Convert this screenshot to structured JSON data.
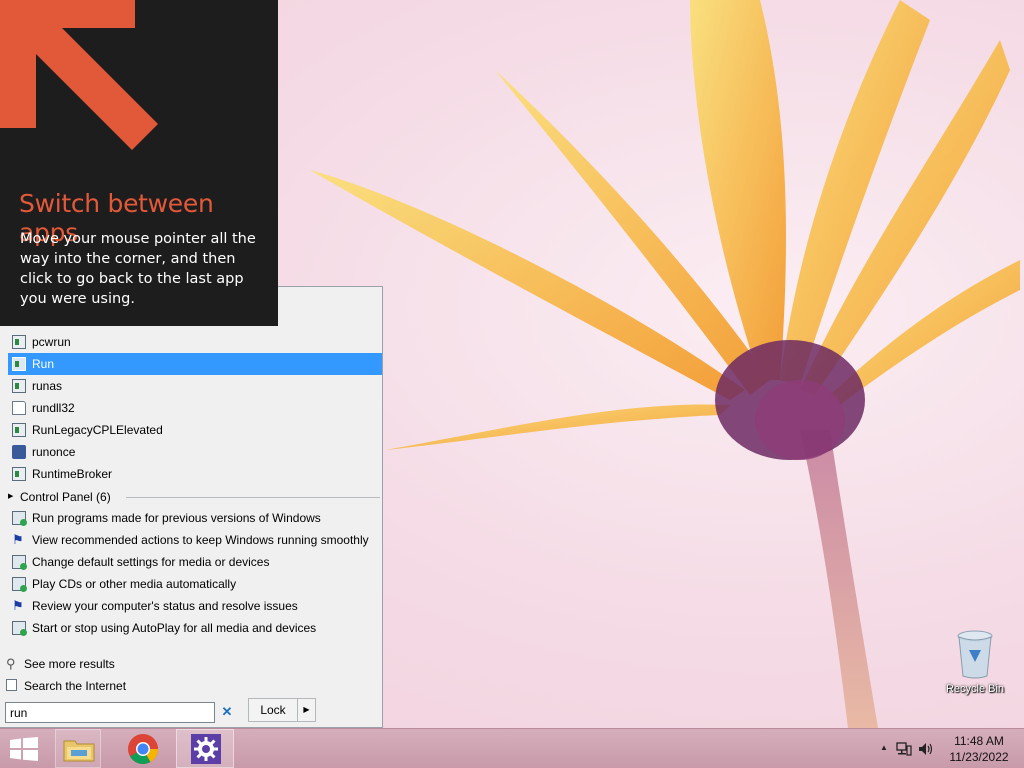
{
  "tip": {
    "title": "Switch between apps",
    "body": "Move your mouse pointer all the way into the corner, and then click to go back to the last app you were using."
  },
  "start_menu": {
    "programs": [
      {
        "label": "pcwrun",
        "icon": "program-icon"
      },
      {
        "label": "Run",
        "icon": "run-icon",
        "selected": true
      },
      {
        "label": "runas",
        "icon": "program-icon"
      },
      {
        "label": "rundll32",
        "icon": "document-icon"
      },
      {
        "label": "RunLegacyCPLElevated",
        "icon": "program-icon"
      },
      {
        "label": "runonce",
        "icon": "installer-icon"
      },
      {
        "label": "RuntimeBroker",
        "icon": "program-icon"
      }
    ],
    "control_panel_header": "Control Panel (6)",
    "control_panel_items": [
      {
        "label": "Run programs made for previous versions of Windows",
        "icon": "compatibility-icon"
      },
      {
        "label": "View recommended actions to keep Windows running smoothly",
        "icon": "flag-icon"
      },
      {
        "label": "Change default settings for media or devices",
        "icon": "autoplay-icon"
      },
      {
        "label": "Play CDs or other media automatically",
        "icon": "autoplay-icon"
      },
      {
        "label": "Review your computer's status and resolve issues",
        "icon": "flag-icon"
      },
      {
        "label": "Start or stop using AutoPlay for all media and devices",
        "icon": "autoplay-icon"
      }
    ],
    "see_more": "See more results",
    "search_internet": "Search the Internet",
    "search_value": "run",
    "lock_label": "Lock"
  },
  "desktop": {
    "recycle_bin_label": "Recycle Bin"
  },
  "taskbar": {
    "time": "11:48 AM",
    "date": "11/23/2022"
  },
  "colors": {
    "tip_background": "#1d1d1d",
    "tip_accent": "#e2593a",
    "selection": "#3399ff",
    "taskbar": "#c89aaa"
  }
}
